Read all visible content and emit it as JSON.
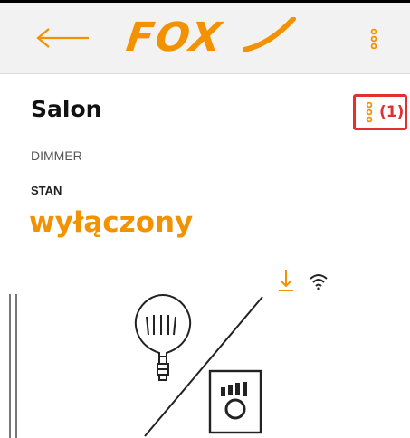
{
  "app_bar": {
    "logo_text": "FOX"
  },
  "device": {
    "name": "Salon",
    "type": "DIMMER",
    "state_label": "STAN",
    "state_value": "wyłączony",
    "menu_annotation": "(1)"
  },
  "icons": {
    "back": "arrow-left-icon",
    "menu": "vertical-dots-icon",
    "download": "download-icon",
    "signal": "wifi-icon",
    "bulb": "light-bulb-icon",
    "dimmer": "dimmer-module-icon"
  },
  "colors": {
    "accent": "#f39200",
    "annotation": "#e03030",
    "app_bar_bg": "#f2f2f2",
    "text": "#111111",
    "muted": "#555555"
  }
}
